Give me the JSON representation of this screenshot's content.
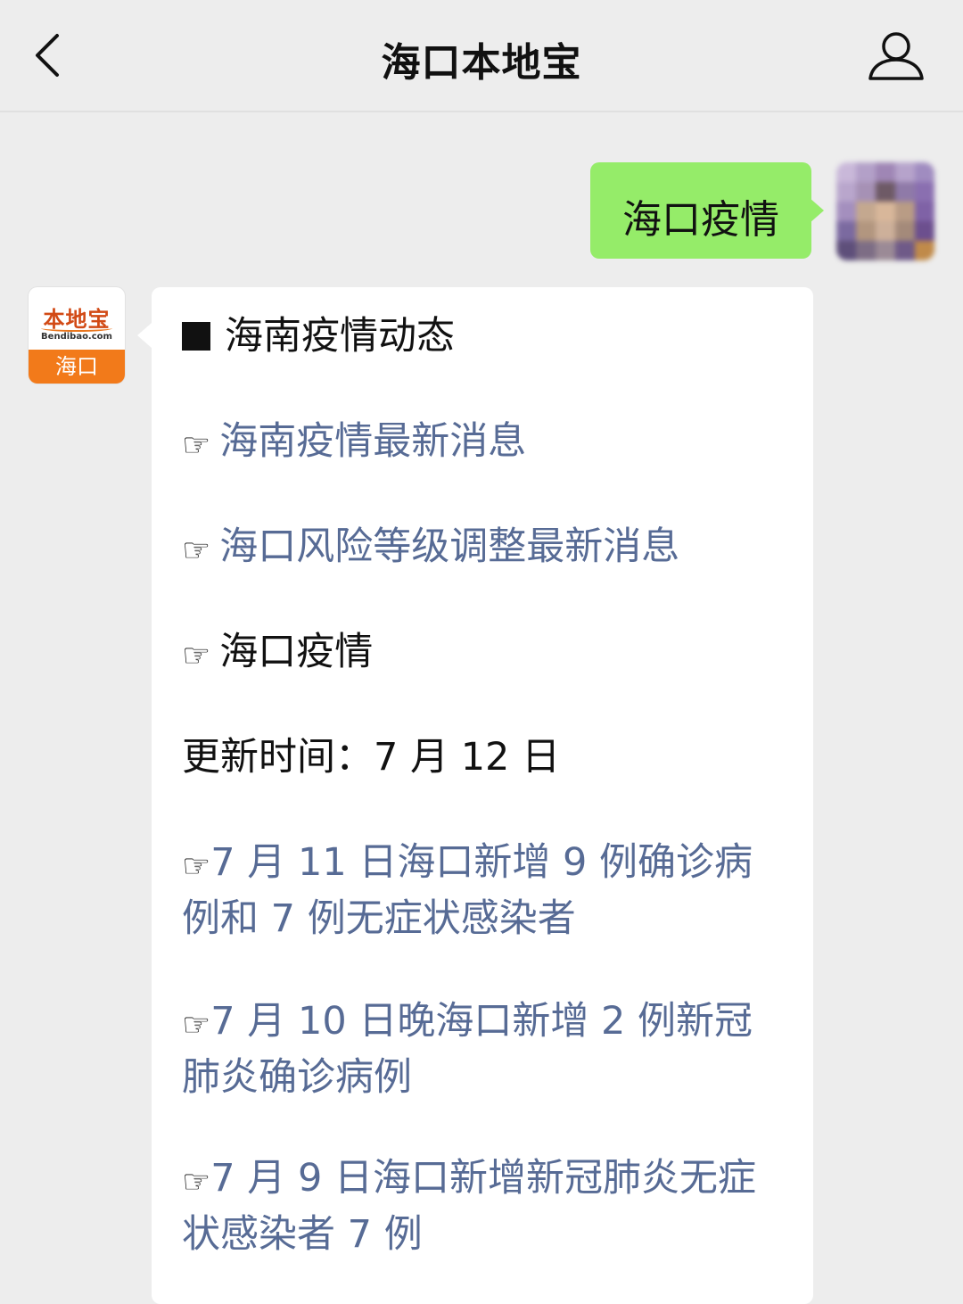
{
  "header": {
    "title": "海口本地宝"
  },
  "messages": {
    "outgoing_text": "海口疫情",
    "bot_avatar": {
      "brand": "本地宝",
      "domain": "Bendibao.com",
      "city": "海口"
    },
    "reply": {
      "heading": "海南疫情动态",
      "pointer_icon": "☞",
      "link_1": "海南疫情最新消息",
      "link_2": "海口风险等级调整最新消息",
      "plain_1": "海口疫情",
      "update_time": "更新时间：7 月 12 日",
      "news_1": "7 月 11 日海口新增 9 例确诊病例和 7 例无症状感染者",
      "news_2": "7 月 10 日晚海口新增 2 例新冠肺炎确诊病例",
      "news_3": "7 月 9 日海口新增新冠肺炎无症状感染者 7 例"
    }
  },
  "colors": {
    "background": "#ededed",
    "outgoing_bubble": "#95ec69",
    "link": "#576b95",
    "brand_orange": "#f27a1a"
  }
}
